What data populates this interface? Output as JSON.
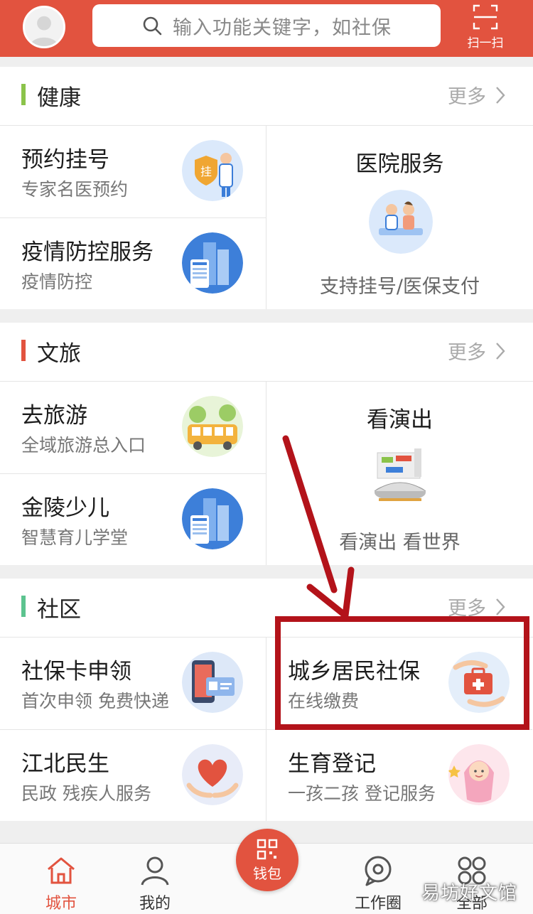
{
  "header": {
    "search_placeholder": "输入功能关键字，如社保",
    "scan_label": "扫一扫"
  },
  "sections": {
    "health": {
      "title": "健康",
      "more": "更多",
      "bar_color": "#8bc34a",
      "items": [
        {
          "title": "预约挂号",
          "subtitle": "专家名医预约",
          "icon": "doctor-badge-icon"
        },
        {
          "title": "疫情防控服务",
          "subtitle": "疫情防控",
          "icon": "building-phone-icon"
        }
      ],
      "feature": {
        "title": "医院服务",
        "subtitle": "支持挂号/医保支付",
        "icon": "hospital-service-icon"
      }
    },
    "travel": {
      "title": "文旅",
      "more": "更多",
      "bar_color": "#e2533f",
      "items": [
        {
          "title": "去旅游",
          "subtitle": "全域旅游总入口",
          "icon": "tour-bus-icon"
        },
        {
          "title": "金陵少儿",
          "subtitle": "智慧育儿学堂",
          "icon": "building-phone-icon"
        }
      ],
      "feature": {
        "title": "看演出",
        "subtitle": "看演出  看世界",
        "icon": "theater-icon"
      }
    },
    "community": {
      "title": "社区",
      "more": "更多",
      "bar_color": "#5cc38f",
      "items": [
        {
          "title": "社保卡申领",
          "subtitle": "首次申领 免费快递",
          "icon": "id-card-phone-icon"
        },
        {
          "title": "城乡居民社保",
          "subtitle": "在线缴费",
          "icon": "medical-kit-icon"
        },
        {
          "title": "江北民生",
          "subtitle": "民政  残疾人服务",
          "icon": "heart-hands-icon"
        },
        {
          "title": "生育登记",
          "subtitle": "一孩二孩 登记服务",
          "icon": "baby-icon"
        }
      ]
    }
  },
  "tabbar": {
    "tabs": [
      {
        "label": "城市",
        "icon": "home-icon"
      },
      {
        "label": "我的",
        "icon": "person-icon"
      },
      {
        "label": "钱包",
        "icon": "qr-wallet-icon"
      },
      {
        "label": "工作圈",
        "icon": "chat-icon"
      },
      {
        "label": "全部",
        "icon": "grid-icon"
      }
    ],
    "active_color": "#e2533f"
  },
  "watermark": "易坊好文馆",
  "colors": {
    "brand": "#e2533f",
    "highlight": "#b3131a"
  }
}
